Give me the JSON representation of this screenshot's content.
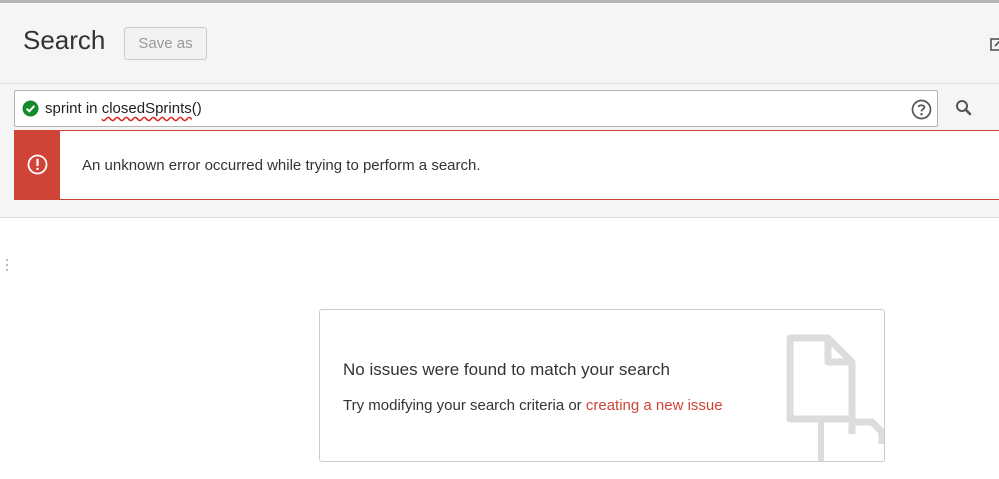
{
  "header": {
    "title": "Search",
    "save_as_label": "Save as"
  },
  "search": {
    "query_keyword": "sprint in ",
    "query_function": "closedSprints",
    "query_parens": "()",
    "validation_state": "valid"
  },
  "error": {
    "message": "An unknown error occurred while trying to perform a search."
  },
  "empty_state": {
    "title": "No issues were found to match your search",
    "description": "Try modifying your search criteria or",
    "link_label": "creating a new issue"
  },
  "icons": {
    "valid": "check-circle-icon",
    "help": "help-icon",
    "search": "search-icon",
    "error": "error-icon",
    "share": "share-icon",
    "illustration": "document-icon"
  },
  "colors": {
    "error": "#d04437",
    "success": "#14892c",
    "link": "#d04437",
    "header_bg": "#f5f5f5"
  }
}
